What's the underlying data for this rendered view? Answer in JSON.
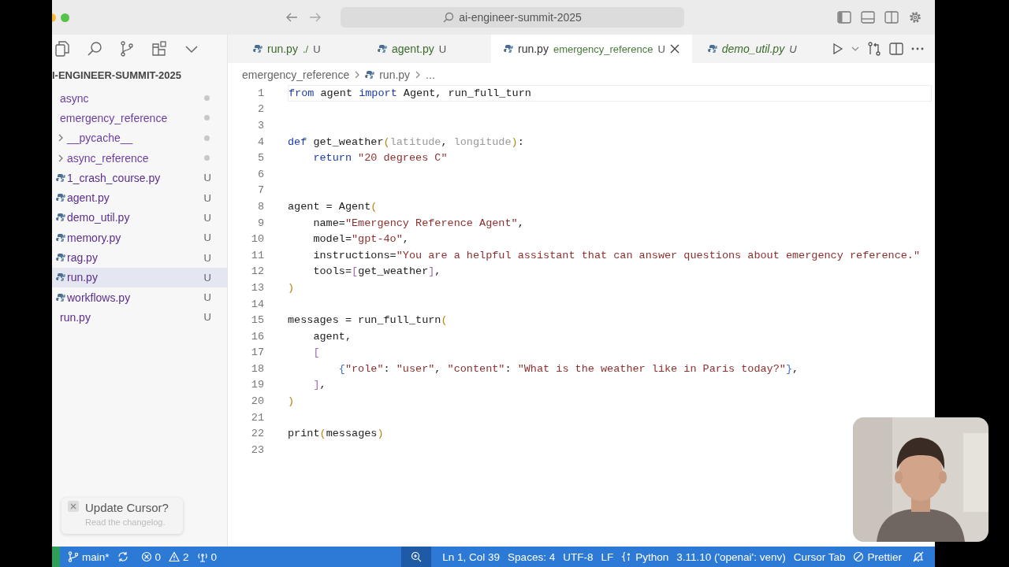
{
  "titlebar": {
    "search": "ai-engineer-summit-2025"
  },
  "tabs": [
    {
      "name": "run.py",
      "detail": "./",
      "badge": "U",
      "selected": false,
      "preview": false
    },
    {
      "name": "agent.py",
      "badge": "U",
      "selected": false,
      "preview": false
    },
    {
      "name": "run.py",
      "detail": "emergency_reference",
      "badge": "U",
      "selected": true,
      "preview": false
    },
    {
      "name": "demo_util.py",
      "badge": "U",
      "selected": false,
      "preview": true
    }
  ],
  "sidebar": {
    "title": "I-ENGINEER-SUMMIT-2025",
    "tree": [
      {
        "name": "async",
        "kind": "folder",
        "dot": true,
        "selected": false
      },
      {
        "name": "emergency_reference",
        "kind": "folder",
        "dot": true,
        "selected": false,
        "children": [
          {
            "name": "__pycache__",
            "kind": "folder",
            "expanded": false,
            "dot": true,
            "selected": false
          },
          {
            "name": "async_reference",
            "kind": "folder",
            "expanded": false,
            "dot": true,
            "selected": false
          },
          {
            "name": "1_crash_course.py",
            "kind": "file",
            "badge": "U",
            "selected": false
          },
          {
            "name": "agent.py",
            "kind": "file",
            "badge": "U",
            "selected": false
          },
          {
            "name": "demo_util.py",
            "kind": "file",
            "badge": "U",
            "selected": false
          },
          {
            "name": "memory.py",
            "kind": "file",
            "badge": "U",
            "selected": false
          },
          {
            "name": "rag.py",
            "kind": "file",
            "badge": "U",
            "selected": false
          },
          {
            "name": "run.py",
            "kind": "file",
            "badge": "U",
            "selected": true
          },
          {
            "name": "workflows.py",
            "kind": "file",
            "badge": "U",
            "selected": false
          }
        ]
      },
      {
        "name": "run.py",
        "kind": "file",
        "badge": "U",
        "selected": false
      }
    ]
  },
  "breadcrumb": [
    "emergency_reference",
    "run.py",
    "..."
  ],
  "code": [
    {
      "number": "1",
      "current": true,
      "tokens": [
        {
          "kind": "kw",
          "text": "from"
        },
        {
          "kind": "plain",
          "text": " agent "
        },
        {
          "kind": "kw",
          "text": "import"
        },
        {
          "kind": "plain",
          "text": " Agent, run_full_turn"
        }
      ]
    },
    {
      "number": "2",
      "current": false
    },
    {
      "number": "3",
      "current": false
    },
    {
      "number": "4",
      "current": false,
      "tokens": [
        {
          "kind": "kw",
          "text": "def"
        },
        {
          "kind": "plain",
          "text": " get_weather"
        },
        {
          "kind": "b1",
          "text": "("
        },
        {
          "kind": "param",
          "text": "latitude"
        },
        {
          "kind": "plain",
          "text": ", "
        },
        {
          "kind": "param",
          "text": "longitude"
        },
        {
          "kind": "b1",
          "text": ")"
        },
        {
          "kind": "plain",
          "text": ":"
        }
      ]
    },
    {
      "number": "5",
      "current": false,
      "tokens": [
        {
          "kind": "kw",
          "text": "    return"
        },
        {
          "kind": "str",
          "text": " \"20 degrees C\""
        }
      ]
    },
    {
      "number": "6",
      "current": false
    },
    {
      "number": "7",
      "current": false
    },
    {
      "number": "8",
      "current": false,
      "tokens": [
        {
          "kind": "plain",
          "text": "agent = Agent"
        },
        {
          "kind": "b1",
          "text": "("
        }
      ]
    },
    {
      "number": "9",
      "current": false,
      "tokens": [
        {
          "kind": "plain",
          "text": "    name="
        },
        {
          "kind": "str",
          "text": "\"Emergency Reference Agent\""
        },
        {
          "kind": "plain",
          "text": ","
        }
      ]
    },
    {
      "number": "10",
      "current": false,
      "tokens": [
        {
          "kind": "plain",
          "text": "    model="
        },
        {
          "kind": "str",
          "text": "\"gpt-4o\""
        },
        {
          "kind": "plain",
          "text": ","
        }
      ]
    },
    {
      "number": "11",
      "current": false,
      "tokens": [
        {
          "kind": "plain",
          "text": "    instructions="
        },
        {
          "kind": "str",
          "text": "\"You are a helpful assistant that can answer questions about emergency reference.\""
        }
      ]
    },
    {
      "number": "12",
      "current": false,
      "tokens": [
        {
          "kind": "plain",
          "text": "    tools="
        },
        {
          "kind": "b2",
          "text": "["
        },
        {
          "kind": "plain",
          "text": "get_weather"
        },
        {
          "kind": "b2",
          "text": "]"
        },
        {
          "kind": "plain",
          "text": ","
        }
      ]
    },
    {
      "number": "13",
      "current": false,
      "tokens": [
        {
          "kind": "b1",
          "text": ")"
        }
      ]
    },
    {
      "number": "14",
      "current": false
    },
    {
      "number": "15",
      "current": false,
      "tokens": [
        {
          "kind": "plain",
          "text": "messages = run_full_turn"
        },
        {
          "kind": "b1",
          "text": "("
        }
      ]
    },
    {
      "number": "16",
      "current": false,
      "tokens": [
        {
          "kind": "plain",
          "text": "    agent,"
        }
      ]
    },
    {
      "number": "17",
      "current": false,
      "tokens": [
        {
          "kind": "b2",
          "text": "    ["
        }
      ]
    },
    {
      "number": "18",
      "current": false,
      "tokens": [
        {
          "kind": "b3",
          "text": "        {"
        },
        {
          "kind": "str",
          "text": "\"role\""
        },
        {
          "kind": "plain",
          "text": ": "
        },
        {
          "kind": "str",
          "text": "\"user\""
        },
        {
          "kind": "plain",
          "text": ", "
        },
        {
          "kind": "str",
          "text": "\"content\""
        },
        {
          "kind": "plain",
          "text": ": "
        },
        {
          "kind": "str",
          "text": "\"What is the weather like in Paris today?\""
        },
        {
          "kind": "b3",
          "text": "}"
        },
        {
          "kind": "plain",
          "text": ","
        }
      ]
    },
    {
      "number": "19",
      "current": false,
      "tokens": [
        {
          "kind": "b2",
          "text": "    ]"
        },
        {
          "kind": "plain",
          "text": ","
        }
      ]
    },
    {
      "number": "20",
      "current": false,
      "tokens": [
        {
          "kind": "b1",
          "text": ")"
        }
      ]
    },
    {
      "number": "21",
      "current": false
    },
    {
      "number": "22",
      "current": false,
      "tokens": [
        {
          "kind": "plain",
          "text": "print"
        },
        {
          "kind": "b1",
          "text": "("
        },
        {
          "kind": "plain",
          "text": "messages"
        },
        {
          "kind": "b1",
          "text": ")"
        }
      ]
    },
    {
      "number": "23",
      "current": false
    }
  ],
  "toast": {
    "title": "Update Cursor?",
    "message": "Read the changelog."
  },
  "status_bar": {
    "left": [
      {
        "kind": "branch",
        "text": "main*"
      },
      {
        "kind": "sync"
      },
      {
        "kind": "error",
        "text": "0"
      },
      {
        "kind": "warning",
        "text": "2"
      },
      {
        "kind": "ports",
        "text": "0"
      }
    ],
    "right": [
      {
        "kind": "zoom"
      },
      {
        "kind": "text",
        "text": "Ln 1, Col 39"
      },
      {
        "kind": "text",
        "text": "Spaces: 4"
      },
      {
        "kind": "text",
        "text": "UTF-8"
      },
      {
        "kind": "text",
        "text": "LF"
      },
      {
        "kind": "language",
        "text": "Python"
      },
      {
        "kind": "text",
        "text": "3.11.10 ('openai': venv)"
      },
      {
        "kind": "text",
        "text": "Cursor Tab"
      },
      {
        "kind": "formatter",
        "text": "Prettier"
      },
      {
        "kind": "notifications"
      }
    ]
  },
  "webcam": {
    "kind": "picture"
  }
}
